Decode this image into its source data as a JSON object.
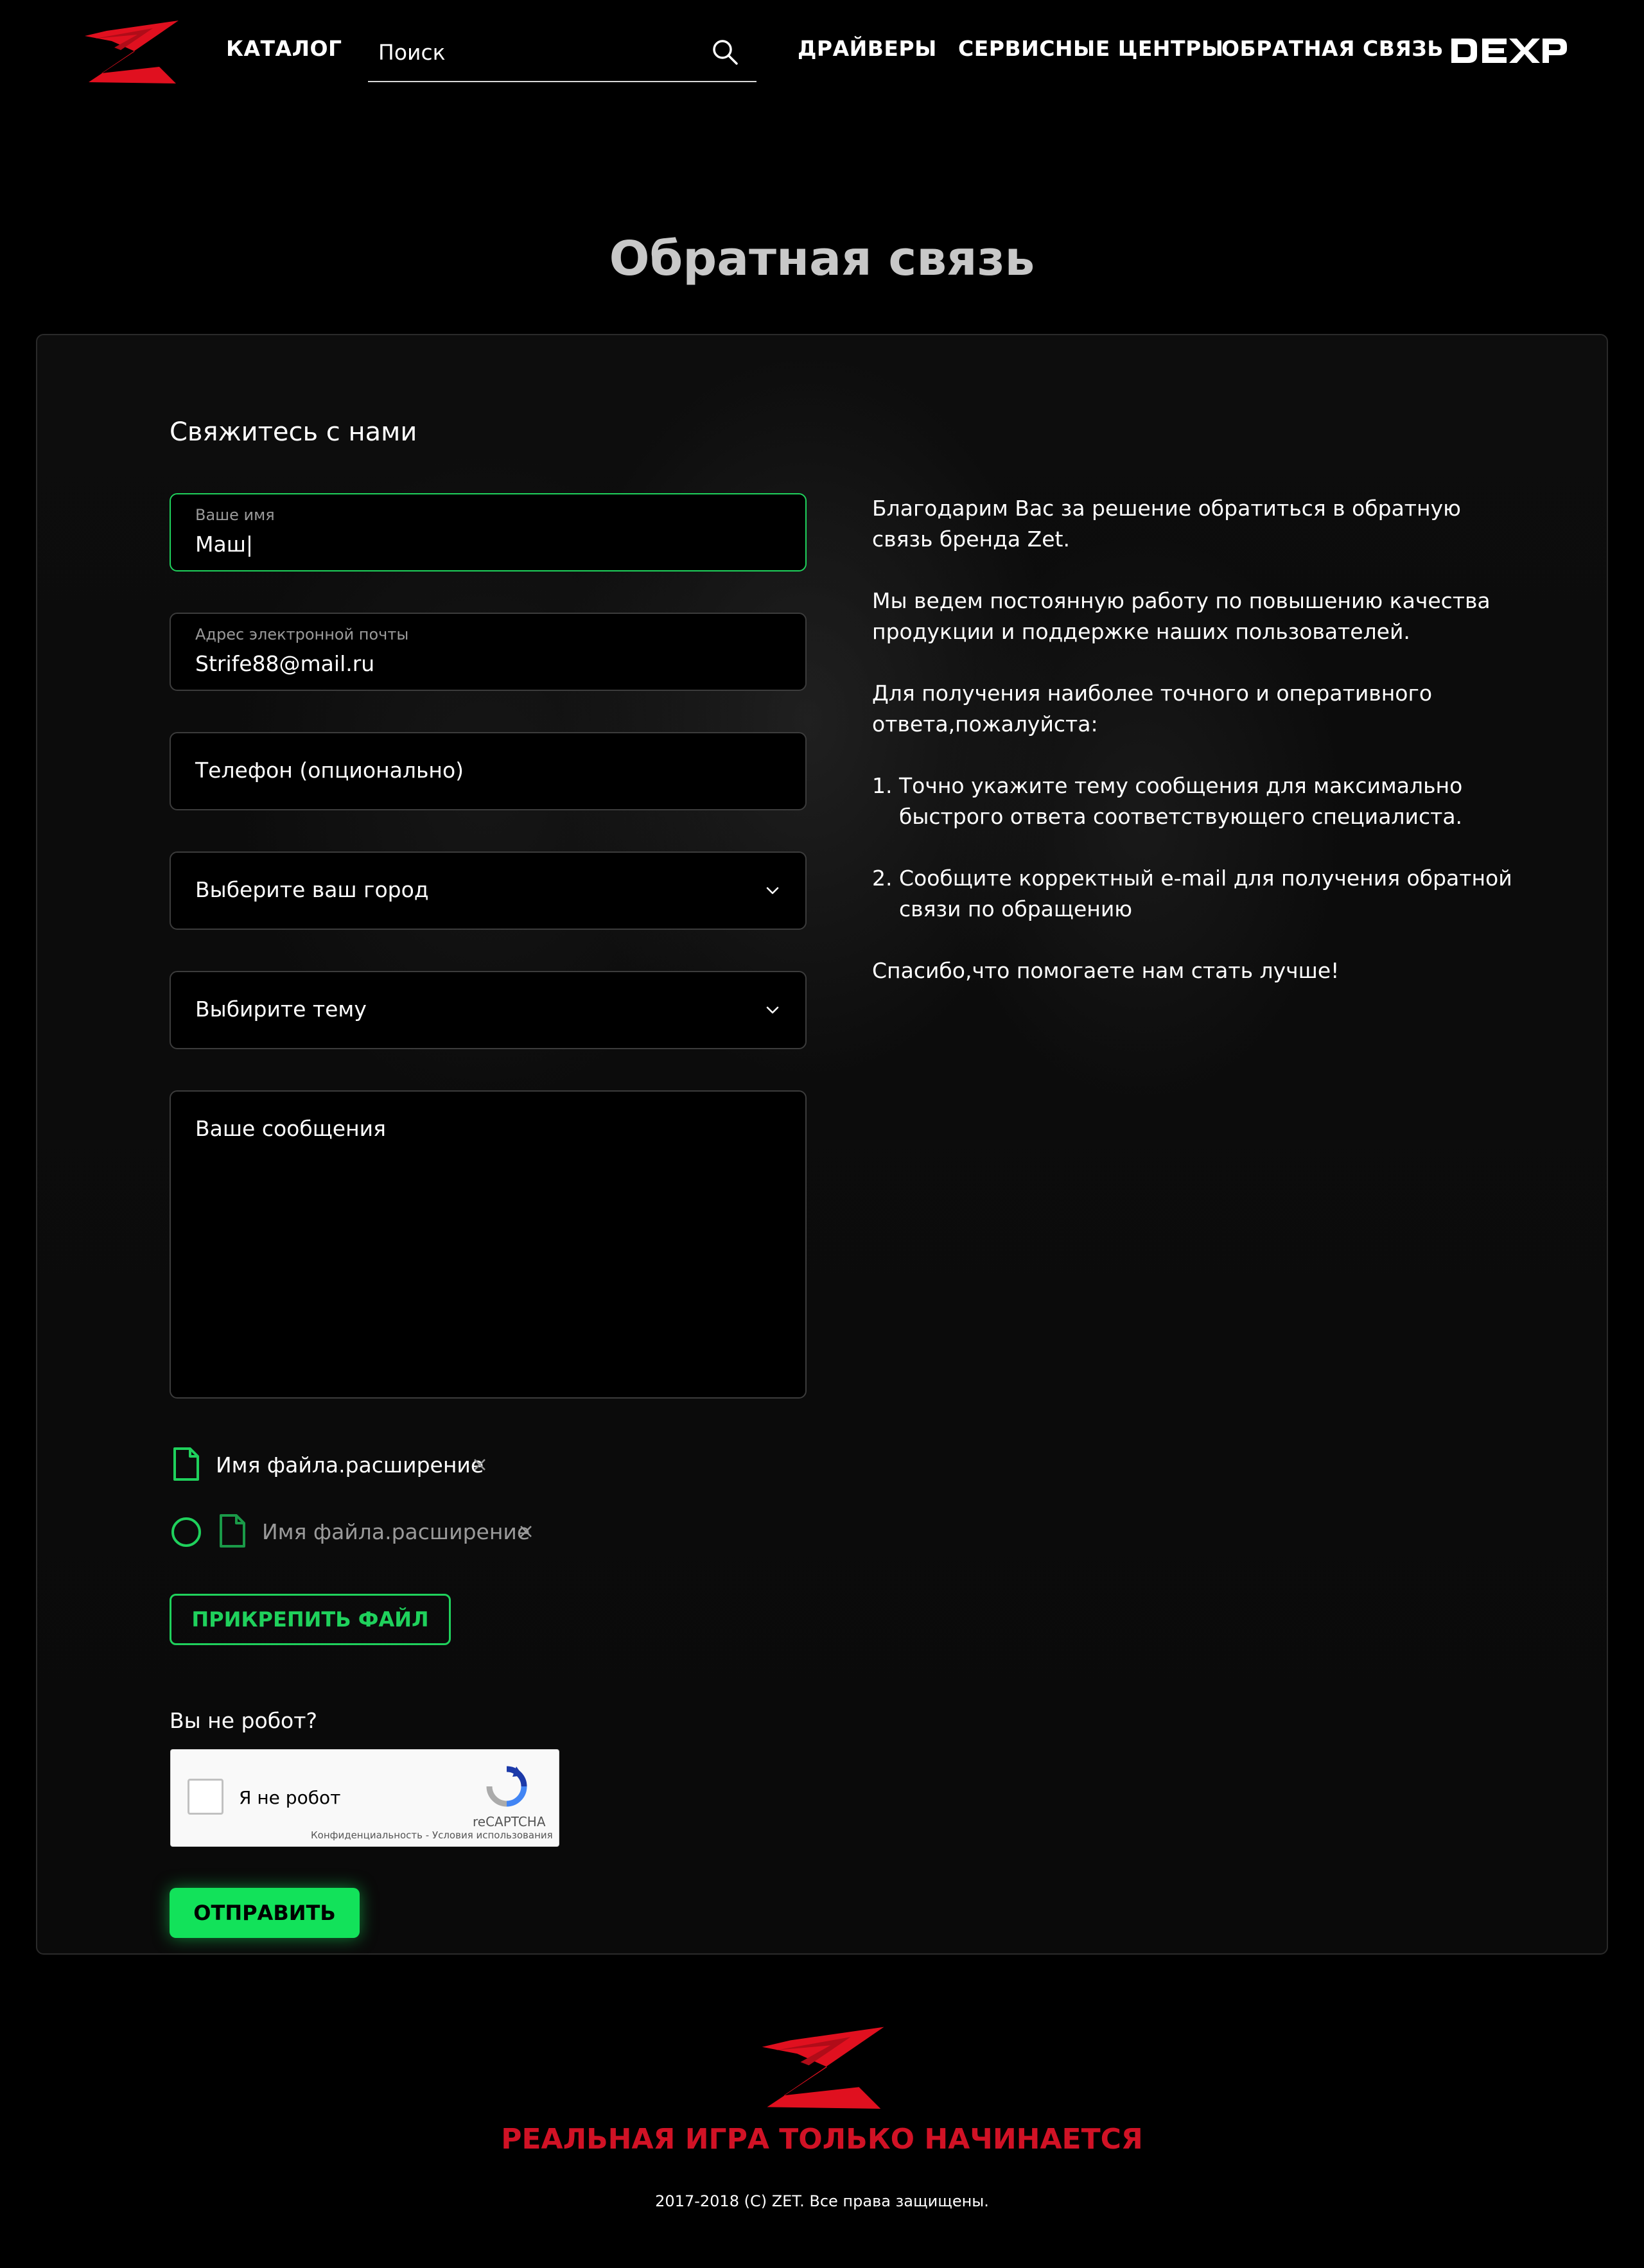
{
  "header": {
    "nav_catalog": "КАТАЛОГ",
    "search_placeholder": "Поиск",
    "nav_drivers": "ДРАЙВЕРЫ",
    "nav_service": "СЕРВИСНЫЕ ЦЕНТРЫ",
    "nav_feedback": "ОБРАТНАЯ СВЯЗЬ",
    "partner_logo_text": "DEXP"
  },
  "page_title": "Обратная связь",
  "form": {
    "heading": "Свяжитесь с нами",
    "name": {
      "label": "Ваше имя",
      "value": "Маш|"
    },
    "email": {
      "label": "Адрес электронной почты",
      "value": "Strife88@mail.ru"
    },
    "phone": {
      "placeholder": "Телефон (опционально)"
    },
    "city": {
      "placeholder": "Выберите ваш город"
    },
    "topic": {
      "placeholder": "Выбирите тему"
    },
    "message": {
      "placeholder": "Ваше сообщения"
    },
    "files": [
      {
        "name": "Имя файла.расширение",
        "status": "uploaded"
      },
      {
        "name": "Имя файла.расширение",
        "status": "uploading"
      }
    ],
    "attach_button": "ПРИКРЕПИТЬ ФАЙЛ",
    "robot_label": "Вы не робот?",
    "captcha": {
      "checkbox_text": "Я не робот",
      "brand": "reCAPTCHA",
      "terms": "Конфиденциальность - Условия использования"
    },
    "submit_button": "ОТПРАВИТЬ"
  },
  "info": {
    "p1": "Благодарим Вас за решение обратиться в обратную связь бренда Zet.",
    "p2": "Мы ведем постоянную работу по повышению качества продукции и поддержке наших пользователей.",
    "p3": "Для получения наиболее точного и оперативного ответа,пожалуйста:",
    "item1": "1. Точно укажите тему сообщения для максимально быстрого ответа соответствующего специалиста.",
    "item2": "2. Сообщите корректный e-mail для получения обратной связи по обращению",
    "p4": "Спасибо,что помогаете нам стать лучше!"
  },
  "footer": {
    "slogan": "РЕАЛЬНАЯ ИГРА ТОЛЬКО НАЧИНАЕТСЯ",
    "copyright": "2017-2018 (С) ZET. Все права защищены."
  },
  "colors": {
    "background": "#000000",
    "accent_green": "#1fd15c",
    "submit_green": "#12e25a",
    "brand_red": "#d11225",
    "title_gray": "#c8c8c8"
  },
  "icons": [
    "zet-logo-icon",
    "search-icon",
    "dexp-logo-icon",
    "chevron-down-icon",
    "file-icon",
    "close-icon",
    "spinner-icon",
    "recaptcha-icon"
  ]
}
